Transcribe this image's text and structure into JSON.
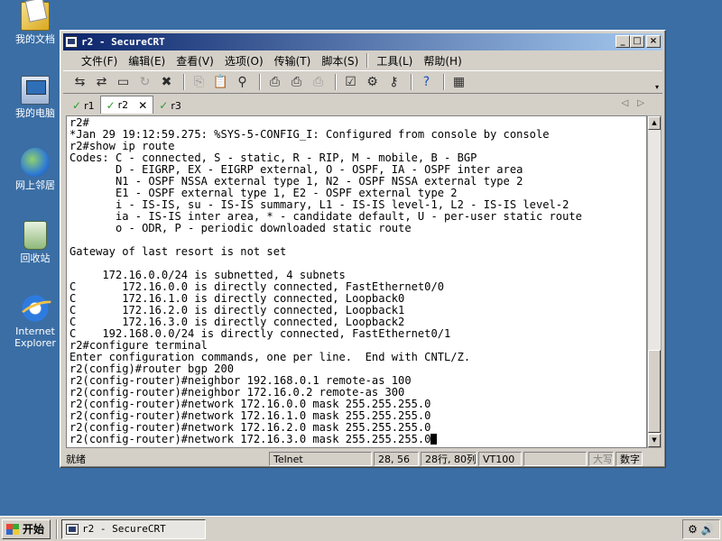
{
  "desktop": {
    "icons": [
      {
        "label": "我的文档"
      },
      {
        "label": "我的电脑"
      },
      {
        "label": "网上邻居"
      },
      {
        "label": "回收站"
      },
      {
        "label": "Internet Explorer"
      }
    ]
  },
  "window": {
    "title": "r2 - SecureCRT",
    "buttons": {
      "minimize": "_",
      "maximize": "□",
      "close": "×"
    }
  },
  "menu": [
    "文件(F)",
    "编辑(E)",
    "查看(V)",
    "选项(O)",
    "传输(T)",
    "脚本(S)",
    "工具(L)",
    "帮助(H)"
  ],
  "tabs": [
    {
      "label": "r1",
      "active": false
    },
    {
      "label": "r2",
      "active": true
    },
    {
      "label": "r3",
      "active": false
    }
  ],
  "terminal": {
    "lines": [
      "r2#",
      "*Jan 29 19:12:59.275: %SYS-5-CONFIG_I: Configured from console by console",
      "r2#show ip route",
      "Codes: C - connected, S - static, R - RIP, M - mobile, B - BGP",
      "       D - EIGRP, EX - EIGRP external, O - OSPF, IA - OSPF inter area",
      "       N1 - OSPF NSSA external type 1, N2 - OSPF NSSA external type 2",
      "       E1 - OSPF external type 1, E2 - OSPF external type 2",
      "       i - IS-IS, su - IS-IS summary, L1 - IS-IS level-1, L2 - IS-IS level-2",
      "       ia - IS-IS inter area, * - candidate default, U - per-user static route",
      "       o - ODR, P - periodic downloaded static route",
      "",
      "Gateway of last resort is not set",
      "",
      "     172.16.0.0/24 is subnetted, 4 subnets",
      "C       172.16.0.0 is directly connected, FastEthernet0/0",
      "C       172.16.1.0 is directly connected, Loopback0",
      "C       172.16.2.0 is directly connected, Loopback1",
      "C       172.16.3.0 is directly connected, Loopback2",
      "C    192.168.0.0/24 is directly connected, FastEthernet0/1",
      "r2#configure terminal",
      "Enter configuration commands, one per line.  End with CNTL/Z.",
      "r2(config)#router bgp 200",
      "r2(config-router)#neighbor 192.168.0.1 remote-as 100",
      "r2(config-router)#neighbor 172.16.0.2 remote-as 300",
      "r2(config-router)#network 172.16.0.0 mask 255.255.255.0",
      "r2(config-router)#network 172.16.1.0 mask 255.255.255.0",
      "r2(config-router)#network 172.16.2.0 mask 255.255.255.0"
    ],
    "last_line": "r2(config-router)#network 172.16.3.0 mask 255.255.255.0"
  },
  "status": {
    "ready": "就绪",
    "protocol": "Telnet",
    "cursor_pos": "28, 56",
    "size": "28行, 80列",
    "emulation": "VT100",
    "blank": "",
    "caps": "大写",
    "num": "数字"
  },
  "taskbar": {
    "start": "开始",
    "task_title": "r2 - SecureCRT"
  }
}
